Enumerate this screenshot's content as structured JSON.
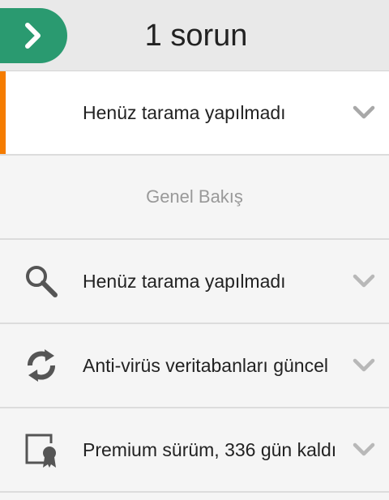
{
  "header": {
    "title": "1 sorun",
    "back_icon": "chevron-right-icon",
    "accent_color": "#2a9a70"
  },
  "alert_row": {
    "label": "Henüz tarama yapılmadı",
    "accent_color": "#f57c00"
  },
  "section": {
    "title": "Genel Bakış"
  },
  "items": [
    {
      "label": "Henüz tarama yapılmadı",
      "icon": "search-icon"
    },
    {
      "label": "Anti-virüs veritabanları güncel",
      "icon": "refresh-icon"
    },
    {
      "label": "Premium sürüm, 336 gün kaldı",
      "icon": "certificate-icon"
    }
  ]
}
